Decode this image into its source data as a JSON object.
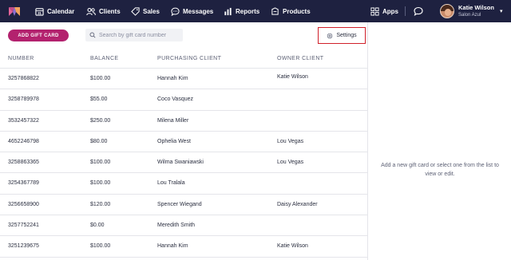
{
  "nav": {
    "items": [
      {
        "label": "Calendar",
        "icon": "calendar-icon"
      },
      {
        "label": "Clients",
        "icon": "users-icon"
      },
      {
        "label": "Sales",
        "icon": "tag-icon"
      },
      {
        "label": "Messages",
        "icon": "chat-icon"
      },
      {
        "label": "Reports",
        "icon": "bar-chart-icon"
      },
      {
        "label": "Products",
        "icon": "box-icon"
      }
    ],
    "apps_label": "Apps",
    "user": {
      "name": "Katie Wilson",
      "salon": "Salon Azul"
    }
  },
  "toolbar": {
    "add_label": "ADD GIFT CARD",
    "search_placeholder": "Search by gift card number",
    "settings_label": "Settings"
  },
  "table": {
    "columns": [
      "NUMBER",
      "BALANCE",
      "PURCHASING CLIENT",
      "OWNER CLIENT"
    ],
    "rows": [
      {
        "number": "3257868822",
        "balance": "$100.00",
        "purchaser": "Hannah Kim",
        "owner": "Katie Wilson"
      },
      {
        "number": "3258789978",
        "balance": "$55.00",
        "purchaser": "Coco Vasquez",
        "owner": ""
      },
      {
        "number": "3532457322",
        "balance": "$250.00",
        "purchaser": "Milena Miller",
        "owner": ""
      },
      {
        "number": "4652246798",
        "balance": "$80.00",
        "purchaser": "Ophelia West",
        "owner": "Lou Vegas"
      },
      {
        "number": "3258863365",
        "balance": "$100.00",
        "purchaser": "Wilma Swaniawski",
        "owner": "Lou Vegas"
      },
      {
        "number": "3254367789",
        "balance": "$100.00",
        "purchaser": "Lou Tralala",
        "owner": ""
      },
      {
        "number": "3256658900",
        "balance": "$120.00",
        "purchaser": "Spencer Wiegand",
        "owner": "Daisy Alexander"
      },
      {
        "number": "3257752241",
        "balance": "$0.00",
        "purchaser": "Meredith Smith",
        "owner": ""
      },
      {
        "number": "3251239675",
        "balance": "$100.00",
        "purchaser": "Hannah Kim",
        "owner": "Katie Wilson"
      }
    ]
  },
  "detail": {
    "empty_message": "Add a new gift card or select one from the list to view or edit."
  },
  "colors": {
    "nav_bg": "#1e2140",
    "accent": "#b3226e",
    "highlight_border": "#d0202a"
  }
}
